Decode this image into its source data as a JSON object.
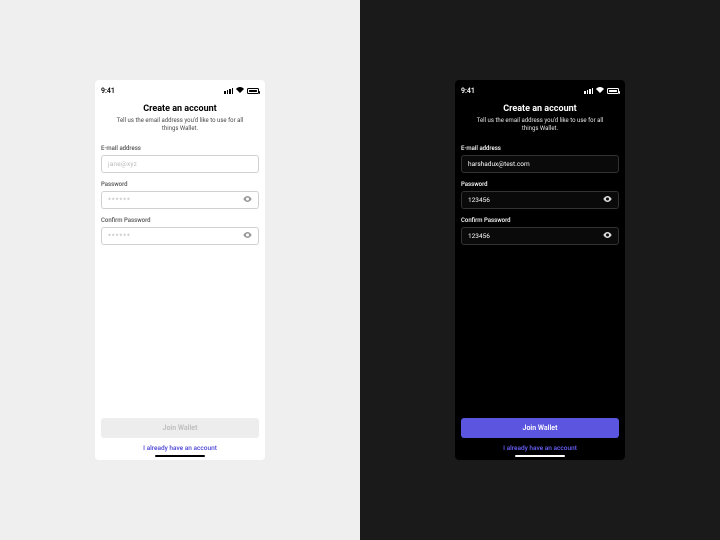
{
  "status": {
    "time": "9:41"
  },
  "heading": "Create an account",
  "subheading": "Tell us the email address you'd like to use for all things Wallet.",
  "fields": {
    "email_label": "E-mail address",
    "password_label": "Password",
    "confirm_label": "Confirm Password"
  },
  "light": {
    "email_placeholder": "jane@xyz",
    "password_placeholder": "******",
    "confirm_placeholder": "******"
  },
  "dark": {
    "email_value": "harshadux@test.com",
    "password_value": "123456",
    "confirm_value": "123456"
  },
  "cta_label": "Join Wallet",
  "alt_link": "I already have an account"
}
